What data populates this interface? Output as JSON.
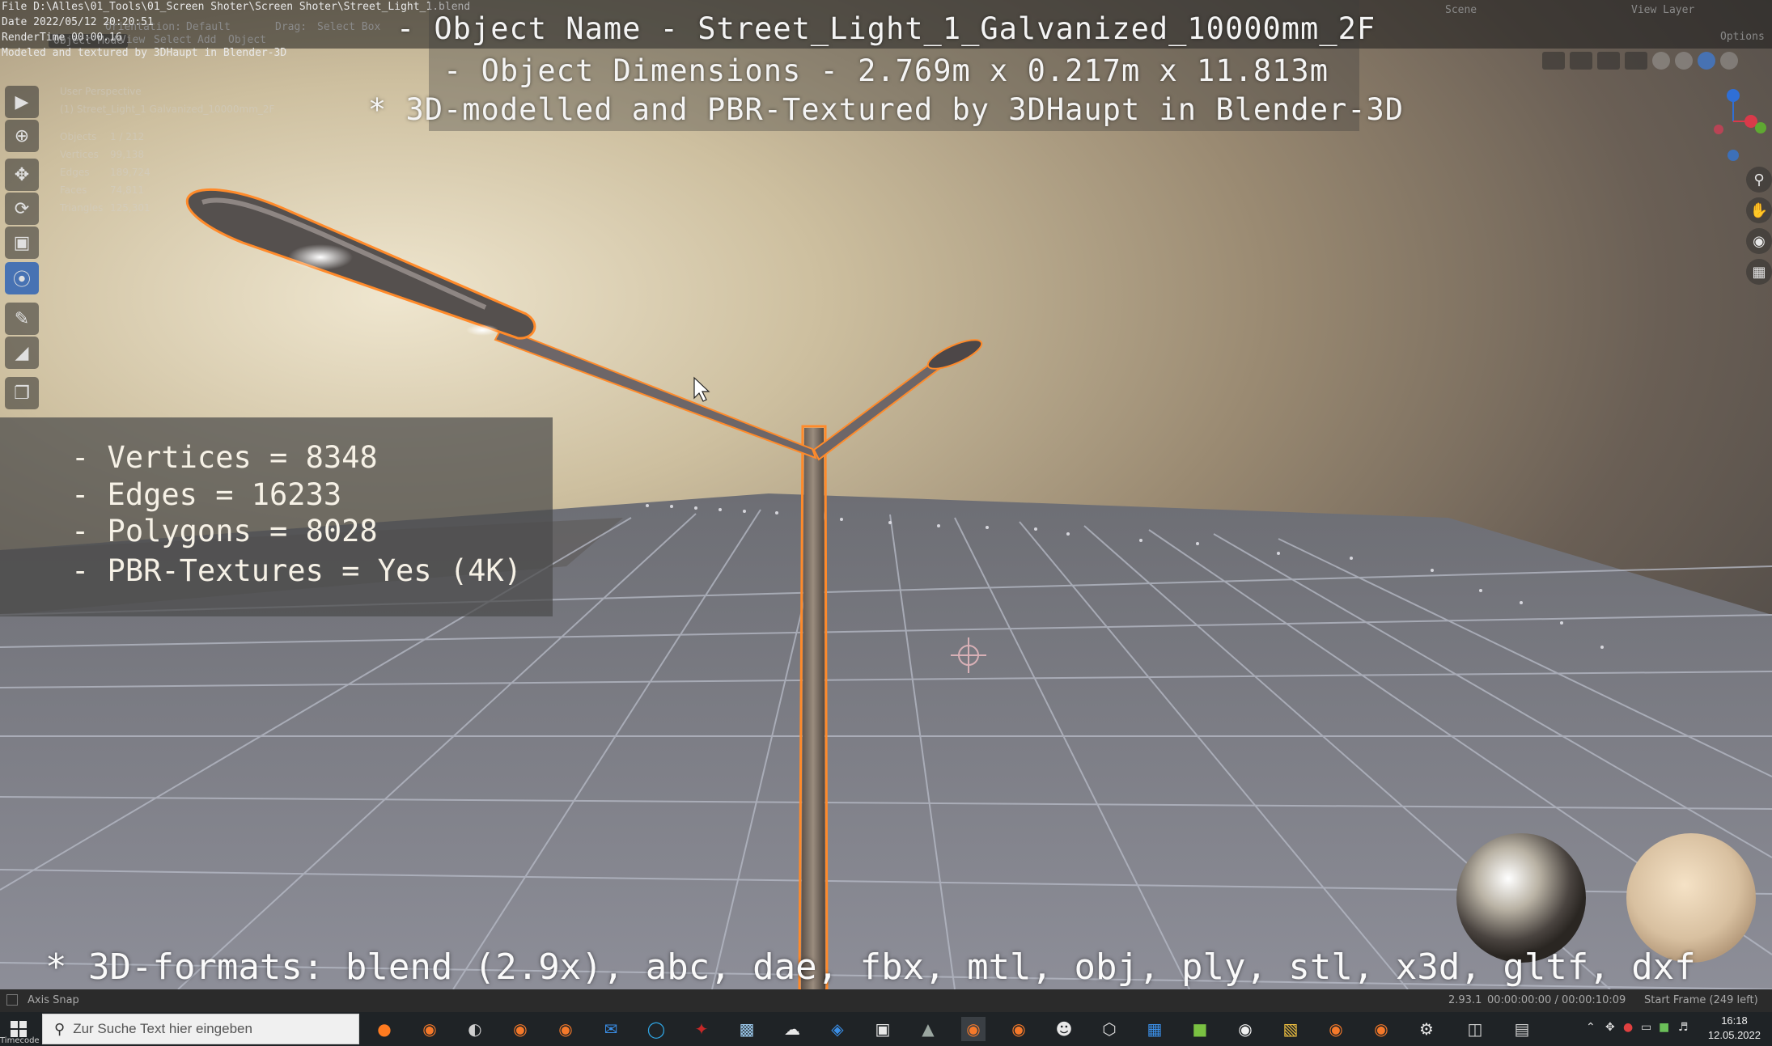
{
  "file_info": {
    "file": "File D:\\Alles\\01_Tools\\01_Screen Shoter\\Screen Shoter\\Street_Light_1.blend",
    "date": "Date 2022/05/12 20:20:51",
    "render_time": "RenderTime 00:00.16",
    "credit": "Modeled and textured by 3DHaupt in Blender-3D"
  },
  "blender_header": {
    "mode": "Object Mode",
    "menus": [
      "View",
      "Select",
      "Add",
      "Object"
    ],
    "orientation_label": "Orientation:",
    "orientation_value": "Default",
    "drag_label": "Drag:",
    "drag_value": "Select Box",
    "scene": "Scene",
    "view_layer": "View Layer",
    "options": "Options"
  },
  "viewport_info": {
    "perspective": "User Perspective",
    "collection": "(1) Street_Light_1 Galvanized_10000mm_2F",
    "stats": [
      {
        "label": "Objects",
        "value": "1 / 212"
      },
      {
        "label": "Vertices",
        "value": "99,138"
      },
      {
        "label": "Edges",
        "value": "189,724"
      },
      {
        "label": "Faces",
        "value": "74,811"
      },
      {
        "label": "Triangles",
        "value": "125,301"
      }
    ]
  },
  "title": {
    "line1": "- Object Name - Street_Light_1_Galvanized_10000mm_2F",
    "line2": "- Object Dimensions -  2.769m x 0.217m x 11.813m",
    "line3": "* 3D-modelled and PBR-Textured by 3DHaupt in Blender-3D"
  },
  "stats_box": {
    "vertices": "- Vertices = 8348",
    "edges": "- Edges = 16233",
    "polygons": "- Polygons = 8028",
    "textures": "- PBR-Textures =  Yes (4K)"
  },
  "formats": "* 3D-formats: blend (2.9x), abc, dae, fbx, mtl, obj, ply, stl, x3d, gltf, dxf",
  "status_bar": {
    "left": "Axis Snap",
    "version": "2.93.1",
    "timecode": "00:00:00:00 / 00:00:10:09",
    "frame": "Start Frame (249 left)",
    "timecode_label": "Timecode"
  },
  "taskbar": {
    "search_placeholder": "Zur Suche Text hier eingeben",
    "time": "16:18",
    "date": "12.05.2022"
  },
  "colors": {
    "accent_blue": "#4772b3",
    "selection_outline": "#ff8a2a",
    "taskbar_bg": "#1f2326"
  }
}
